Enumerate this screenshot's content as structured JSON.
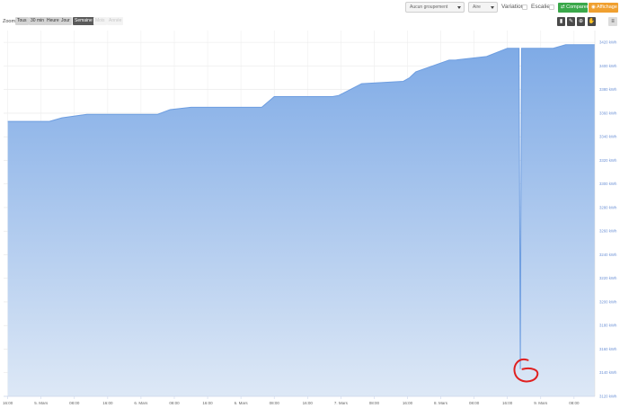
{
  "toolbar": {
    "grouping": "Aucun groupement",
    "chart_type": "Aire",
    "variation_label": "Variation",
    "escalier_label": "Escalier",
    "compare_label": "Comparer",
    "affichage_label": "Affichage",
    "compare_icon": "compare-icon",
    "affichage_icon": "display-icon"
  },
  "zoom": {
    "label": "Zoom",
    "buttons": [
      {
        "label": "Tous",
        "state": "normal"
      },
      {
        "label": "30 min",
        "state": "normal"
      },
      {
        "label": "Heure",
        "state": "normal"
      },
      {
        "label": "Jour",
        "state": "normal"
      },
      {
        "label": "Semaine",
        "state": "active"
      },
      {
        "label": "Mois",
        "state": "disabled"
      },
      {
        "label": "Année",
        "state": "disabled"
      }
    ]
  },
  "tools": [
    {
      "icon": "bar-icon"
    },
    {
      "icon": "pencil-icon"
    },
    {
      "icon": "crosshair-icon"
    },
    {
      "icon": "hand-icon"
    }
  ],
  "menu_icon": "hamburger-icon",
  "colors": {
    "area_top": "#7eaae6",
    "area_bottom": "#dde8f6",
    "line": "#6d9de0",
    "annotation": "#e02020",
    "compare_green": "#3aa84a",
    "affichage_orange": "#f0a030"
  },
  "chart_data": {
    "type": "area",
    "ylabel": "",
    "yunit": "kWh",
    "ylim": [
      3120,
      3430
    ],
    "y_ticks": [
      "3120 kWh",
      "3140 kWh",
      "3160 kWh",
      "3180 kWh",
      "3200 kWh",
      "3220 kWh",
      "3240 kWh",
      "3260 kWh",
      "3280 kWh",
      "3300 kWh",
      "3320 kWh",
      "3340 kWh",
      "3360 kWh",
      "3380 kWh",
      "3400 kWh",
      "3420 kWh"
    ],
    "x_ticks": [
      "16:00",
      "5. Mars",
      "08:00",
      "16:00",
      "6. Mars",
      "08:00",
      "16:00",
      "6. Mars",
      "08:00",
      "16:00",
      "7. Mars",
      "08:00",
      "16:00",
      "8. Mars",
      "08:00",
      "16:00",
      "9. Mars",
      "08:00"
    ],
    "x_hours": [
      0,
      8,
      16,
      24,
      32,
      40,
      48,
      56,
      64,
      72,
      80,
      88,
      96,
      104,
      112,
      120,
      128,
      136
    ],
    "xlim": [
      -1,
      141
    ],
    "series": [
      {
        "x": [
          0,
          10,
          13,
          19,
          36,
          39,
          44,
          61,
          64,
          67,
          78,
          79.5,
          85,
          95,
          96.5,
          98,
          106,
          107.5,
          115,
          120,
          122.8,
          123.1,
          123.4,
          124,
          131,
          134,
          138,
          141
        ],
        "y": [
          3353,
          3353,
          3356,
          3359,
          3359,
          3363,
          3365,
          3365,
          3374,
          3374,
          3374,
          3375,
          3385,
          3387,
          3390,
          3395,
          3405,
          3405,
          3408,
          3415,
          3415,
          3143,
          3415,
          3415,
          3415,
          3418,
          3418,
          3418
        ]
      }
    ],
    "grid": true,
    "legend": "none"
  },
  "annotation": {
    "type": "hand-drawn-circle"
  }
}
